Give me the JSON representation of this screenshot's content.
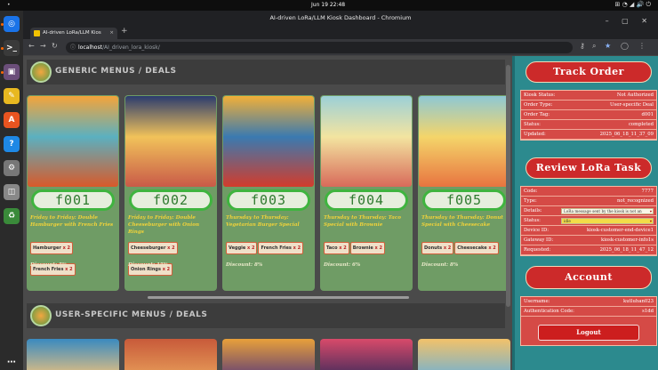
{
  "system_bar": {
    "activities": "•",
    "clock": "Jun 19  22:48",
    "tray": "⊞ ◔ ◢ 🔊 ⏻"
  },
  "dock": {
    "apps": [
      {
        "name": "chromium",
        "glyph": "◎",
        "color": "#1a73e8"
      },
      {
        "name": "terminal",
        "glyph": ">_",
        "color": "#3a3a3a"
      },
      {
        "name": "terminal-2",
        "glyph": "▣",
        "color": "#6b4e7a"
      },
      {
        "name": "text-editor",
        "glyph": "✎",
        "color": "#e8b820"
      },
      {
        "name": "app-center",
        "glyph": "A",
        "color": "#e95420"
      },
      {
        "name": "help",
        "glyph": "?",
        "color": "#1e88e5"
      },
      {
        "name": "settings",
        "glyph": "⚙",
        "color": "#777"
      },
      {
        "name": "files",
        "glyph": "◫",
        "color": "#888"
      },
      {
        "name": "trash",
        "glyph": "♻",
        "color": "#3a8a3a"
      }
    ],
    "show_apps": "⋯"
  },
  "window": {
    "title": "AI-driven LoRa/LLM Kiosk Dashboard - Chromium",
    "controls": "–  ▢  ✕"
  },
  "tab": {
    "label": "AI-driven LoRa/LLM Kios",
    "close": "×",
    "new": "+"
  },
  "omnibox": {
    "host": "localhost",
    "path": "/AI_driven_lora_kiosk/"
  },
  "sections": {
    "generic": "GENERIC MENUS / DEALS",
    "user_specific": "USER-SPECIFIC MENUS / DEALS"
  },
  "cards": [
    {
      "code": "f001",
      "title": "Friday to Friday: Double Hamburger with French Fries",
      "tags": [
        {
          "name": "Hamburger",
          "qty": "x 2"
        },
        {
          "name": "French Fries",
          "qty": "x 2"
        }
      ],
      "discount": "Discount: 5%",
      "palette": [
        "#f4a43a",
        "#d85a2a",
        "#5bb0c0"
      ]
    },
    {
      "code": "f002",
      "title": "Friday to Friday: Double Cheeseburger with Onion Rings",
      "tags": [
        {
          "name": "Cheeseburger",
          "qty": "x 2"
        },
        {
          "name": "Onion Rings",
          "qty": "x 2"
        }
      ],
      "discount": "Discount: 15%",
      "palette": [
        "#2b3c6e",
        "#c95a48",
        "#f1c25a"
      ]
    },
    {
      "code": "f003",
      "title": "Thursday to Thursday: Vegetarian Burger Special",
      "tags": [
        {
          "name": "Veggie",
          "qty": "x 2"
        },
        {
          "name": "French Fries",
          "qty": "x 2"
        }
      ],
      "discount": "Discount: 8%",
      "palette": [
        "#f2b038",
        "#d23c2c",
        "#3a7ab0"
      ]
    },
    {
      "code": "f004",
      "title": "Thursday to Thursday: Taco Special with Brownie",
      "tags": [
        {
          "name": "Taco",
          "qty": "x 2"
        },
        {
          "name": "Brownie",
          "qty": "x 2"
        }
      ],
      "discount": "Discount: 6%",
      "palette": [
        "#9cd0d8",
        "#d86a5a",
        "#f3e4a0"
      ]
    },
    {
      "code": "f005",
      "title": "Thursday to Thursday: Donut Special with Cheesecake",
      "tags": [
        {
          "name": "Donuts",
          "qty": "x 2"
        },
        {
          "name": "Cheesecake",
          "qty": "x 2"
        }
      ],
      "discount": "Discount: 8%",
      "palette": [
        "#8ec8d4",
        "#e87440",
        "#f4d56a"
      ]
    }
  ],
  "second_row_palettes": [
    [
      "#f4c47a",
      "#3a8ac0"
    ],
    [
      "#e8a05a",
      "#c85a3a"
    ],
    [
      "#5a3a78",
      "#e8a03a"
    ],
    [
      "#3c2a5a",
      "#d84a6a"
    ],
    [
      "#6ab0d8",
      "#f2c26a"
    ]
  ],
  "track_order": {
    "button": "Track Order",
    "rows": [
      {
        "k": "Kiosk Status:",
        "v": "Not Authorized"
      },
      {
        "k": "Order Type:",
        "v": "User-specific Deal"
      },
      {
        "k": "Order Tag:",
        "v": "d001"
      },
      {
        "k": "Status:",
        "v": "completed"
      },
      {
        "k": "Updated:",
        "v": "2025_06_18_11_37_09"
      }
    ]
  },
  "review": {
    "button": "Review LoRa Task",
    "code": {
      "k": "Code:",
      "v": "7777"
    },
    "type": {
      "k": "Type:",
      "v": "not_recognized"
    },
    "details": {
      "k": "Details:",
      "v": "LoRa message sent by the kiosk is not an"
    },
    "status": {
      "k": "Status:",
      "v": "idle"
    },
    "rows": [
      {
        "k": "Device ID:",
        "v": "kiosk-customer-end-device1"
      },
      {
        "k": "Gateway ID:",
        "v": "kiosk-customer-info1s"
      },
      {
        "k": "Requested:",
        "v": "2025_06_18_11_47_12"
      }
    ]
  },
  "account": {
    "button": "Account",
    "rows": [
      {
        "k": "Username:",
        "v": "kutluhan023"
      },
      {
        "k": "Authentication Code:",
        "v": "s1dd"
      }
    ],
    "logout": "Logout"
  }
}
